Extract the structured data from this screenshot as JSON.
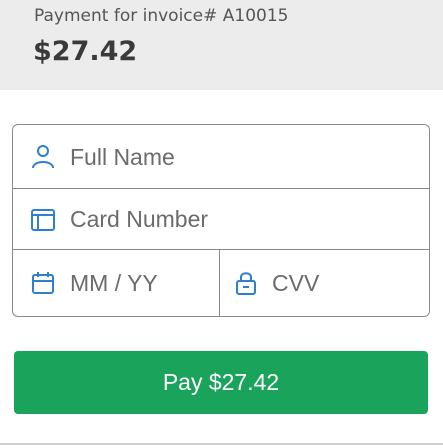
{
  "header": {
    "invoice_label": "Payment for invoice# A10015",
    "amount": "$27.42"
  },
  "form": {
    "name_placeholder": "Full Name",
    "card_placeholder": "Card Number",
    "expiry_placeholder": "MM / YY",
    "cvv_placeholder": "CVV"
  },
  "icons": {
    "name": "user-icon",
    "card": "credit-card-icon",
    "expiry": "calendar-icon",
    "cvv": "lock-icon"
  },
  "pay_button": {
    "label": "Pay $27.42"
  },
  "colors": {
    "header_bg": "#ececec",
    "accent": "#1aa35a",
    "icon": "#2f7fd1",
    "border": "#8a8a8a"
  }
}
